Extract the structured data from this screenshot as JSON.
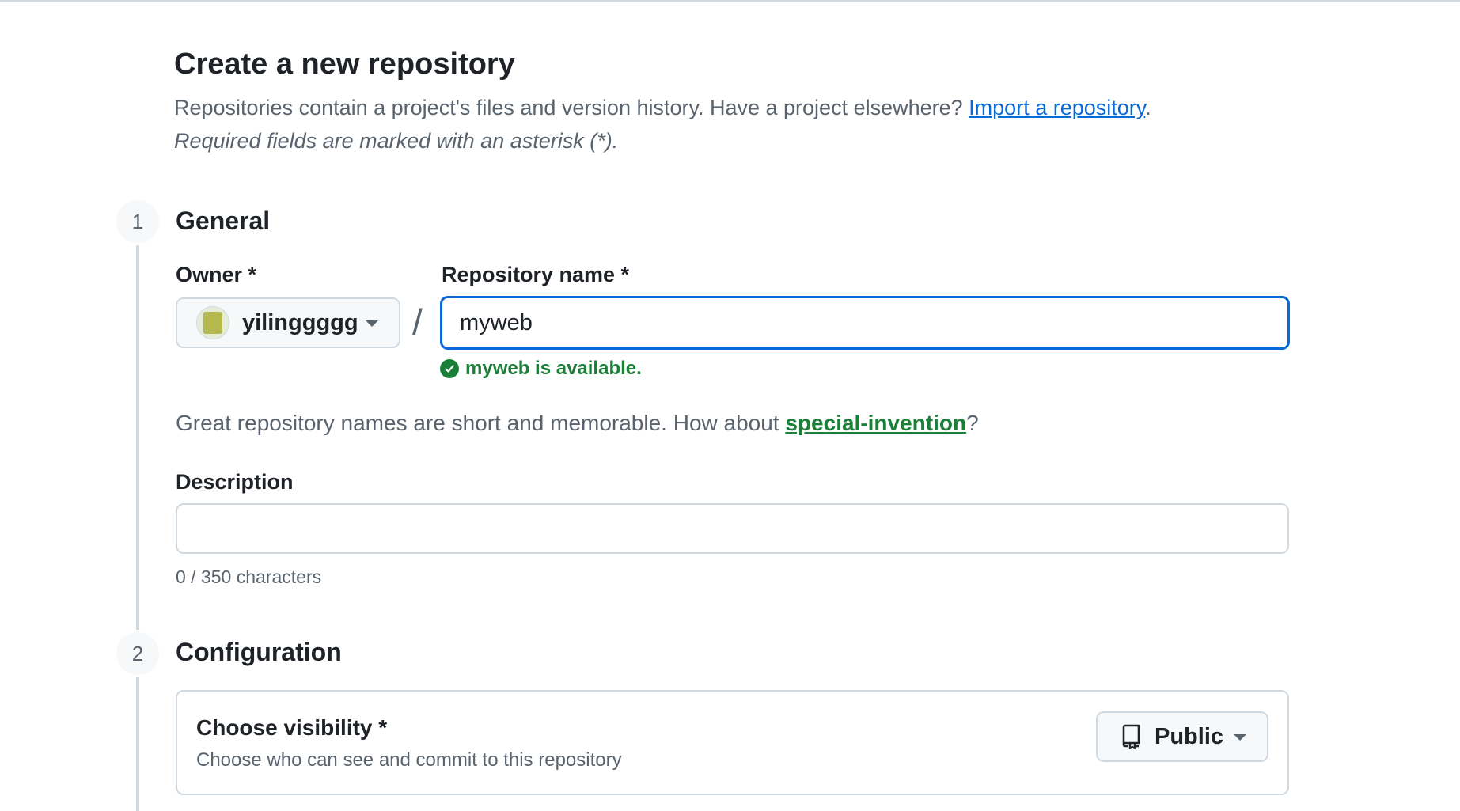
{
  "header": {
    "title": "Create a new repository",
    "subtitle_text": "Repositories contain a project's files and version history. Have a project elsewhere?",
    "import_link": "Import a repository",
    "subtitle_end": ".",
    "required_note": "Required fields are marked with an asterisk (*)."
  },
  "steps": {
    "general": {
      "number": "1",
      "title": "General"
    },
    "configuration": {
      "number": "2",
      "title": "Configuration"
    }
  },
  "owner": {
    "label": "Owner *",
    "value": "yilinggggg",
    "icon": "avatar"
  },
  "separator": "/",
  "repository_name": {
    "label": "Repository name *",
    "value": "myweb",
    "availability": "myweb is available."
  },
  "suggestion": {
    "text": "Great repository names are short and memorable. How about",
    "link": "special-invention",
    "end": "?"
  },
  "description": {
    "label": "Description",
    "value": "",
    "char_count": "0 / 350 characters"
  },
  "visibility": {
    "title": "Choose visibility *",
    "description": "Choose who can see and commit to this repository",
    "value": "Public",
    "icon": "repo-icon"
  },
  "colors": {
    "accent": "#0969da",
    "success": "#1a7f37",
    "border": "#d1d9e0",
    "muted": "#59636e"
  }
}
